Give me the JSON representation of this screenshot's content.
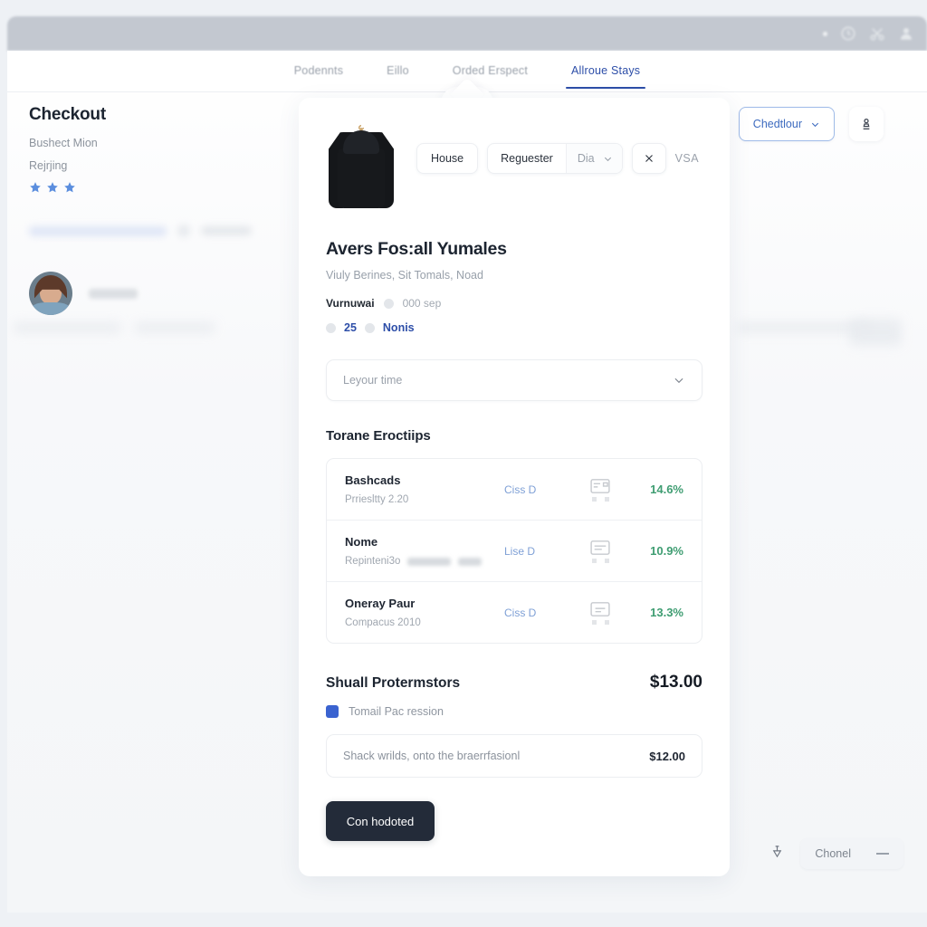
{
  "titlebar": {
    "icons": [
      "dot-indicator",
      "clock-icon",
      "cut-icon",
      "person-icon"
    ]
  },
  "nav": {
    "tabs": [
      {
        "label": "Podennts",
        "active": false
      },
      {
        "label": "Eillo",
        "active": false
      },
      {
        "label": "Orded Erspect",
        "active": false
      },
      {
        "label": "Allroue Stays",
        "active": true
      }
    ]
  },
  "notch": {
    "icon": "flag-bookmark-icon"
  },
  "sidebar": {
    "title": "Checkout",
    "subtitle": "Bushect Mion",
    "subtitle2": "Rejrjing",
    "stars": 3,
    "star_color": "#5b8ede"
  },
  "top_right": {
    "dropdown_label": "Chedtlour",
    "dropdown_icon": "chevron-down-icon",
    "icon_button": "stamp-icon",
    "accent": "#3d6bbf"
  },
  "card": {
    "product_image": "black-hoodie-on-hanger",
    "chips": [
      {
        "type": "plain",
        "label": "House"
      },
      {
        "type": "group",
        "label": "Reguester",
        "select_value": "Dia",
        "select_icon": "chevron-down-icon"
      },
      {
        "type": "icon",
        "label": "",
        "icon": "close-icon"
      },
      {
        "type": "text",
        "label": "VSA"
      }
    ],
    "product_title": "Avers Fos:all Yumales",
    "product_subtitle": "Viuly Berines, Sit Tomals, Noad",
    "meta": {
      "label": "Vurnuwai",
      "value": "000 sep"
    },
    "meta2": {
      "count": "25",
      "link": "Nonis"
    },
    "select": {
      "value": "Leyour time",
      "icon": "chevron-down-icon"
    },
    "section_title": "Torane Eroctiips",
    "rows": [
      {
        "title": "Bashcads",
        "sub": "Prriesltty 2.20",
        "link": "Ciss D",
        "icon": "card-icon",
        "pct": "14.6%"
      },
      {
        "title": "Nome",
        "sub": "Repinteni3o",
        "link": "Lise D",
        "icon": "card-icon",
        "pct": "10.9%",
        "sub_ghost": true
      },
      {
        "title": "Oneray Paur",
        "sub": "Compacus 2010",
        "link": "Ciss D",
        "icon": "card-icon",
        "pct": "13.3%"
      }
    ],
    "pct_color": "#3f9d72",
    "totals": {
      "label": "Shuall Protermstors",
      "value": "$13.00"
    },
    "checkbox": {
      "label": "Tomail Pac ression",
      "checked": true,
      "color": "#3a63d0"
    },
    "note": {
      "text": "Shack wrilds, onto the braerrfasionl",
      "amount": "$12.00"
    },
    "cta": {
      "label": "Con hodoted",
      "bg": "#232b39"
    }
  },
  "bottom_right": {
    "icon": "pin-icon",
    "pill_label": "Chonel",
    "pill_icon": "minimize-dash-icon"
  }
}
